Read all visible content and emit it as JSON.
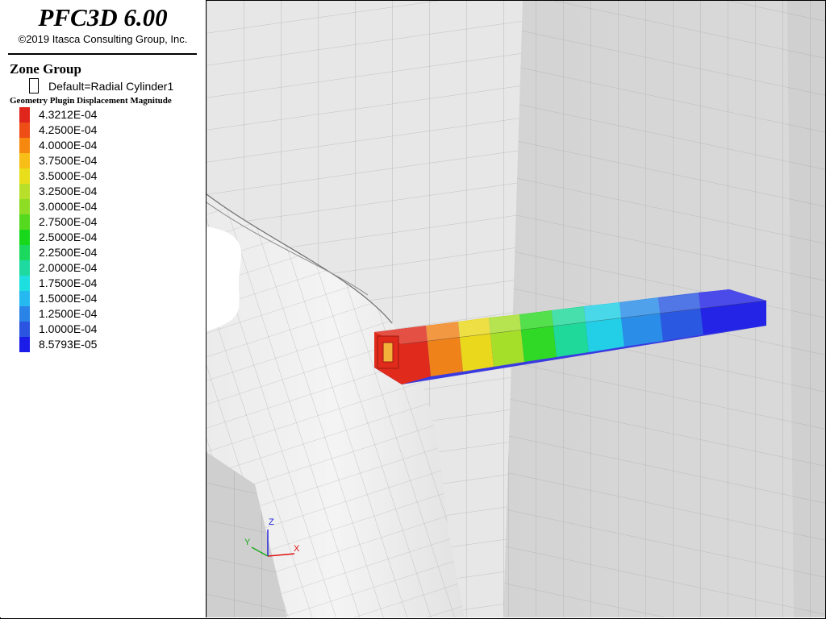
{
  "header": {
    "app_title": "PFC3D 6.00",
    "copyright": "©2019 Itasca Consulting Group, Inc."
  },
  "zone_group": {
    "title": "Zone Group",
    "entry_label": "Default=Radial Cylinder1"
  },
  "contour": {
    "title": "Geometry Plugin Displacement Magnitude",
    "levels": [
      {
        "label": "4.3212E-04",
        "color": "#e0251d"
      },
      {
        "label": "4.2500E-04",
        "color": "#ee4e16"
      },
      {
        "label": "4.0000E-04",
        "color": "#f7880f"
      },
      {
        "label": "3.7500E-04",
        "color": "#f7be17"
      },
      {
        "label": "3.5000E-04",
        "color": "#e8de1b"
      },
      {
        "label": "3.2500E-04",
        "color": "#b8e02b"
      },
      {
        "label": "3.0000E-04",
        "color": "#8edc24"
      },
      {
        "label": "2.7500E-04",
        "color": "#55d91e"
      },
      {
        "label": "2.5000E-04",
        "color": "#18d81c"
      },
      {
        "label": "2.2500E-04",
        "color": "#1bd85e"
      },
      {
        "label": "2.0000E-04",
        "color": "#1ed9a0"
      },
      {
        "label": "1.7500E-04",
        "color": "#1ddfe0"
      },
      {
        "label": "1.5000E-04",
        "color": "#26b8f0"
      },
      {
        "label": "1.2500E-04",
        "color": "#2a84e8"
      },
      {
        "label": "1.0000E-04",
        "color": "#2b54e0"
      },
      {
        "label": "8.5793E-05",
        "color": "#1c1ce8"
      }
    ]
  },
  "axes": {
    "x": "X",
    "y": "Y",
    "z": "Z"
  }
}
